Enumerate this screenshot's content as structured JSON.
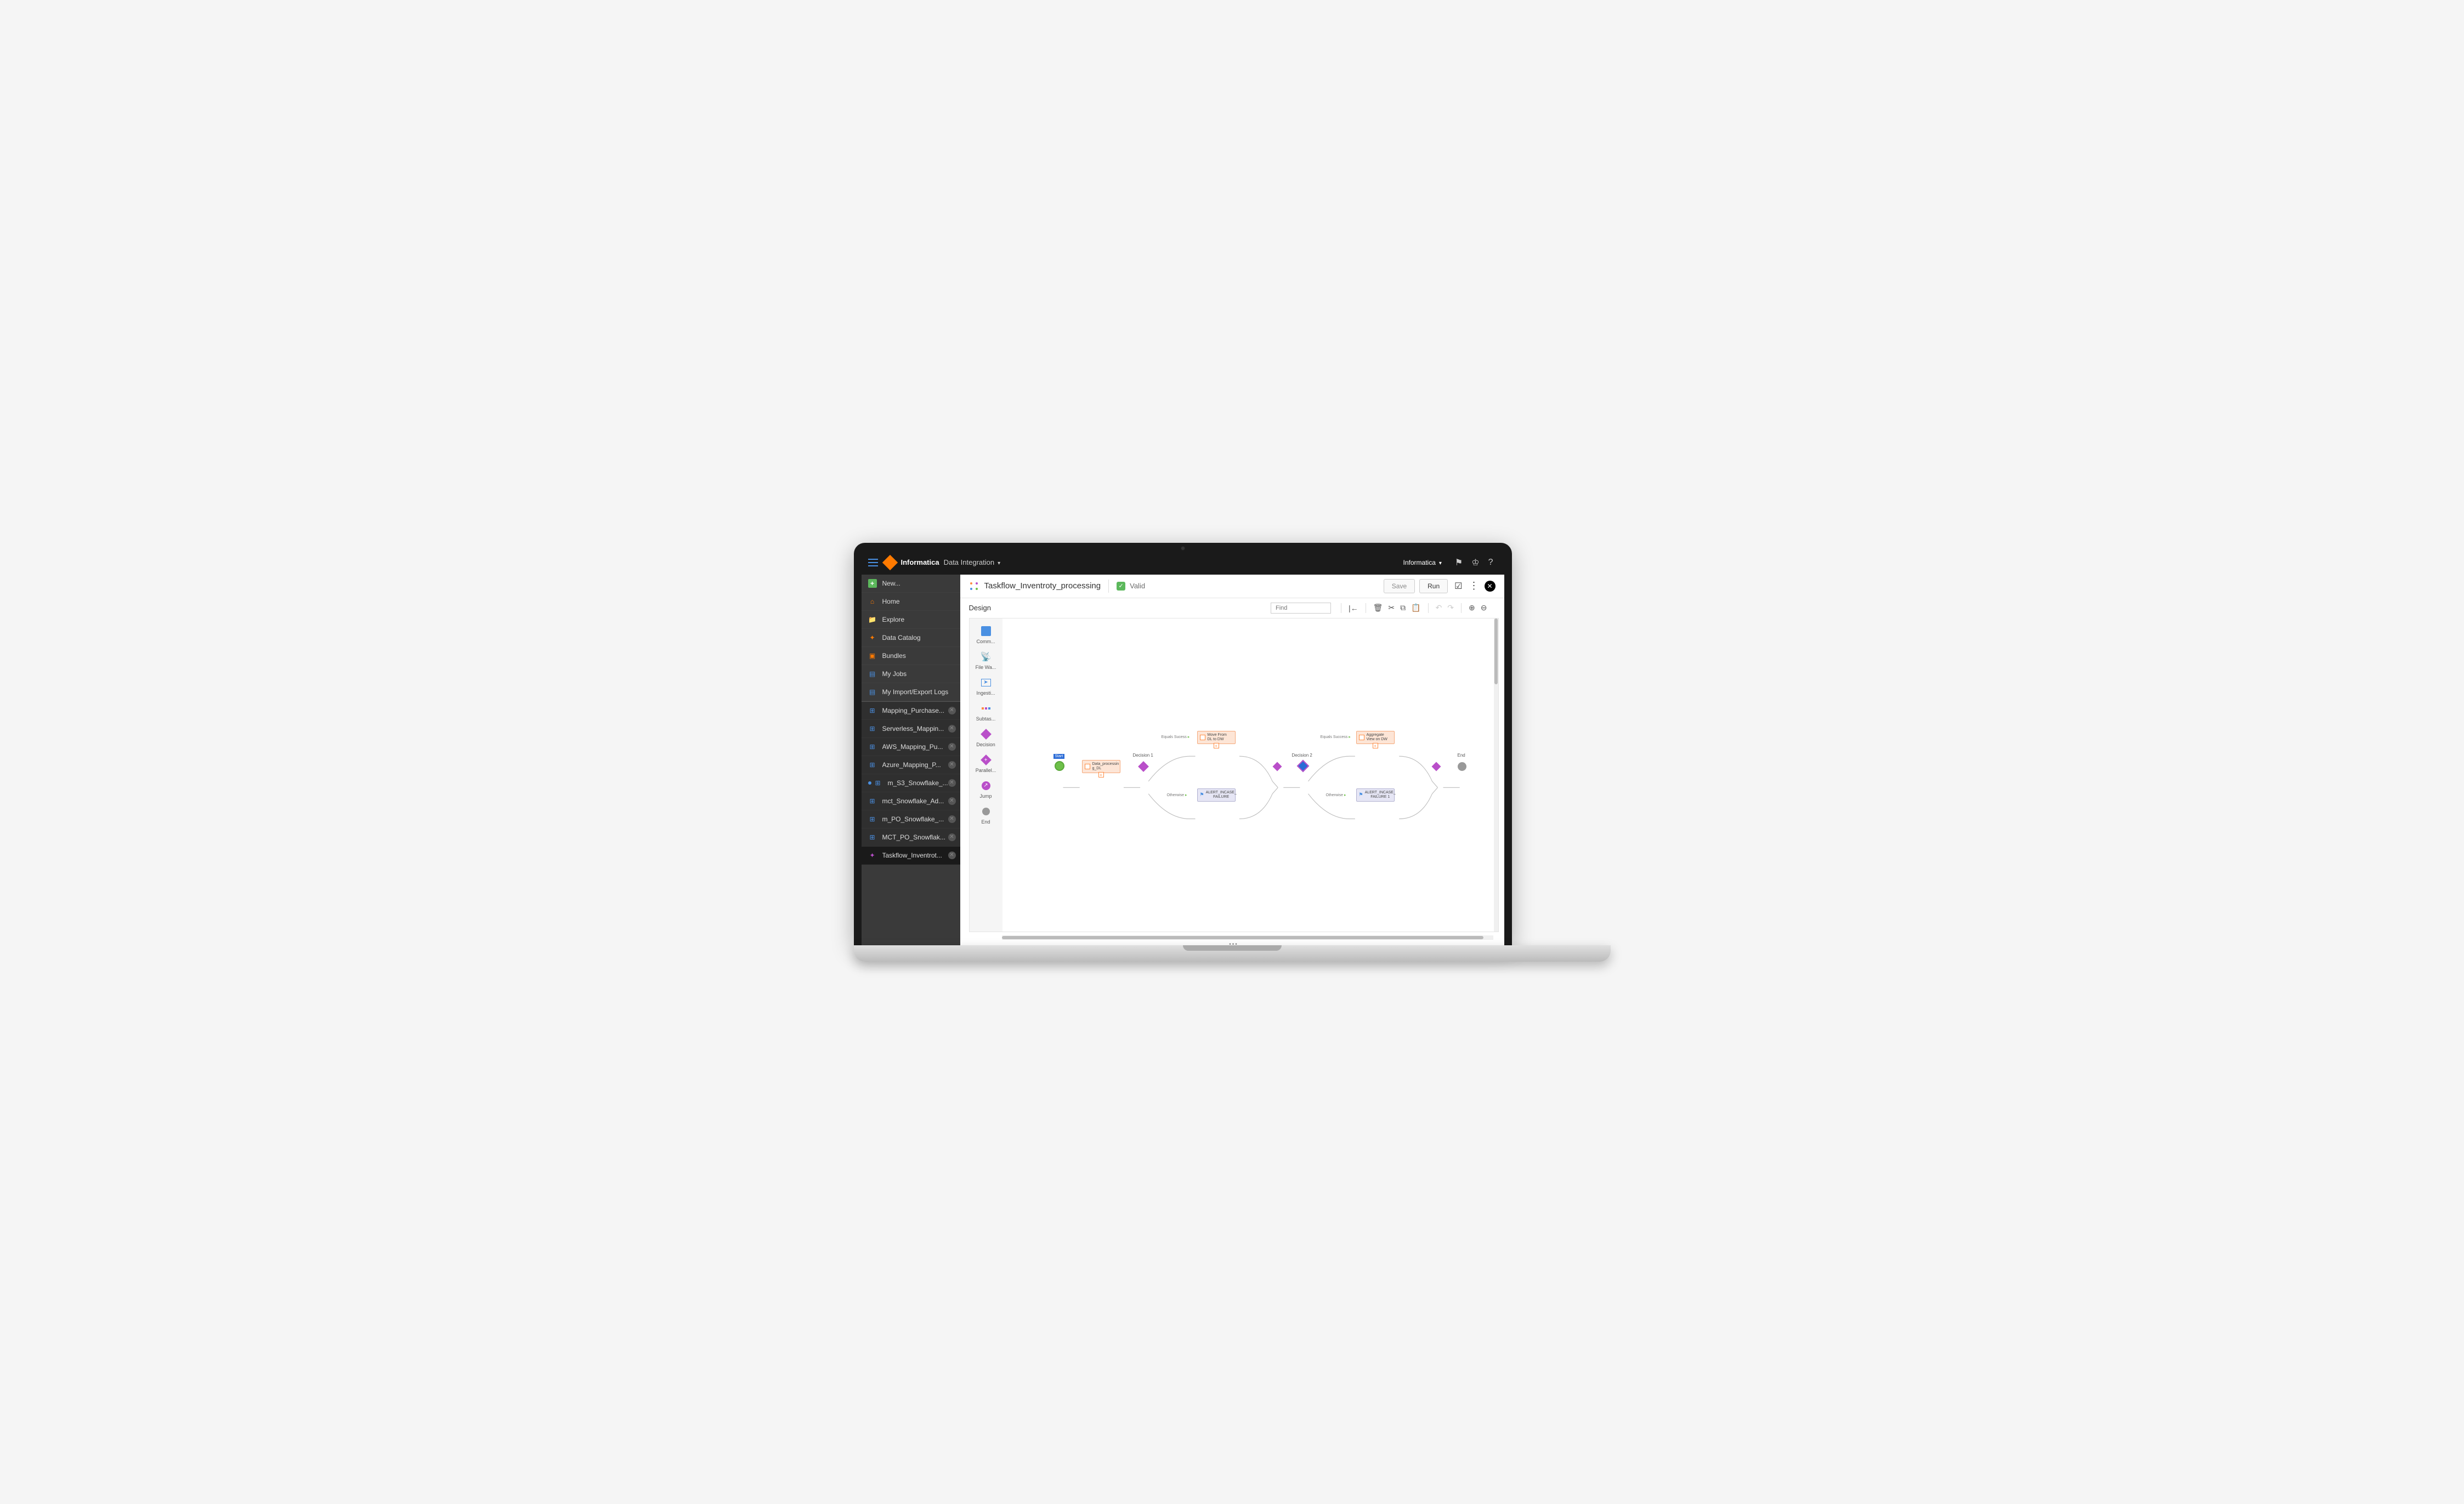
{
  "topnav": {
    "brand": "Informatica",
    "product": "Data Integration",
    "account": "Informatica"
  },
  "sidebar": {
    "primary": [
      {
        "label": "New...",
        "icon": "plus"
      },
      {
        "label": "Home",
        "icon": "home"
      },
      {
        "label": "Explore",
        "icon": "folder"
      },
      {
        "label": "Data Catalog",
        "icon": "catalog"
      },
      {
        "label": "Bundles",
        "icon": "bundle"
      },
      {
        "label": "My Jobs",
        "icon": "jobs"
      },
      {
        "label": "My Import/Export Logs",
        "icon": "logs"
      }
    ],
    "tabs": [
      {
        "label": "Mapping_Purchase...",
        "icon": "map"
      },
      {
        "label": "Serverless_Mappin...",
        "icon": "map"
      },
      {
        "label": "AWS_Mapping_Pu...",
        "icon": "map"
      },
      {
        "label": "Azure_Mapping_P...",
        "icon": "map"
      },
      {
        "label": "m_S3_Snowflake_...",
        "icon": "map",
        "modified": true
      },
      {
        "label": "mct_Snowflake_Ad...",
        "icon": "map"
      },
      {
        "label": "m_PO_Snowflake_...",
        "icon": "map"
      },
      {
        "label": "MCT_PO_Snowflak...",
        "icon": "map"
      },
      {
        "label": "Taskflow_Inventrot...",
        "icon": "task",
        "active": true
      }
    ]
  },
  "header": {
    "title": "Taskflow_Inventroty_processing",
    "valid_label": "Valid",
    "save_label": "Save",
    "run_label": "Run"
  },
  "design": {
    "label": "Design",
    "find_placeholder": "Find"
  },
  "palette": [
    {
      "label": "Comm...",
      "key": "command"
    },
    {
      "label": "File Wa...",
      "key": "filewatch"
    },
    {
      "label": "Ingesti...",
      "key": "ingest"
    },
    {
      "label": "Subtas...",
      "key": "subtask"
    },
    {
      "label": "Decision",
      "key": "decision"
    },
    {
      "label": "Parallel...",
      "key": "parallel"
    },
    {
      "label": "Jump",
      "key": "jump"
    },
    {
      "label": "End",
      "key": "end"
    }
  ],
  "flow": {
    "start_label": "Start",
    "task1": "Data_processin g_DL",
    "decision1_label": "Decision 1",
    "branch1a": "Equals Sucess",
    "task2": "Move From DL to DW",
    "branch1b": "Otherwise",
    "alert1": "ALERT_INCASE_ FAILURE",
    "decision2_label": "Decision 2",
    "branch2a": "Equals Success",
    "task3": "Aggregate View on DW",
    "branch2b": "Otherwise",
    "alert2": "ALERT_INCASE_ FAILURE 1",
    "end_label": "End"
  }
}
